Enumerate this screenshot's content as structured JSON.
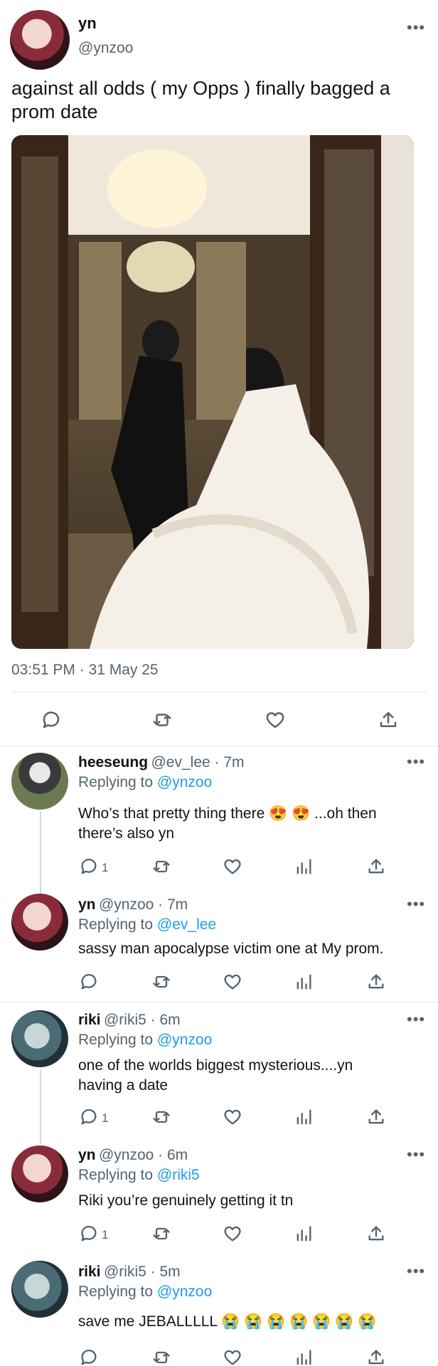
{
  "main_tweet": {
    "name": "yn",
    "handle": "@ynzoo",
    "text_line1": "against all odds ( my Opps ) finally bagged a",
    "text_line2": "prom date",
    "timestamp": "03:51 PM · 31 May 25"
  },
  "replies": [
    {
      "name": "heeseung",
      "handle": "@ev_lee · 7m",
      "replying_prefix": "Replying to ",
      "replying_to": "@ynzoo",
      "line1": "Who’s that pretty thing there 😍 😍 ...oh then",
      "line2": "there’s also yn",
      "reply_count": "1"
    },
    {
      "name": "yn",
      "handle": "@ynzoo · 7m",
      "replying_prefix": "Replying to ",
      "replying_to": "@ev_lee",
      "line1": "sassy man apocalypse victim one at My prom.",
      "line2": "",
      "reply_count": ""
    },
    {
      "name": "riki",
      "handle": "@riki5 · 6m",
      "replying_prefix": "Replying to ",
      "replying_to": "@ynzoo",
      "line1": "one of the worlds biggest mysterious....yn",
      "line2": "having a date",
      "reply_count": "1"
    },
    {
      "name": "yn",
      "handle": "@ynzoo · 6m",
      "replying_prefix": "Replying to ",
      "replying_to": "@riki5",
      "line1": "Riki you’re genuinely getting it tn",
      "line2": "",
      "reply_count": "1"
    },
    {
      "name": "riki",
      "handle": "@riki5 · 5m",
      "replying_prefix": "Replying to ",
      "replying_to": "@ynzoo",
      "line1": "save me JEBALLLLL 😭 😭 😭 😭 😭 😭 😭",
      "line2": "",
      "reply_count": ""
    }
  ],
  "more_glyph": "•••",
  "icons": [
    "reply-icon",
    "retweet-icon",
    "like-icon",
    "views-icon",
    "share-icon",
    "more-icon"
  ],
  "colors": {
    "accent": "#1d9bf0",
    "muted": "#536471",
    "text": "#0f1419",
    "divider": "#e6e6e6"
  }
}
